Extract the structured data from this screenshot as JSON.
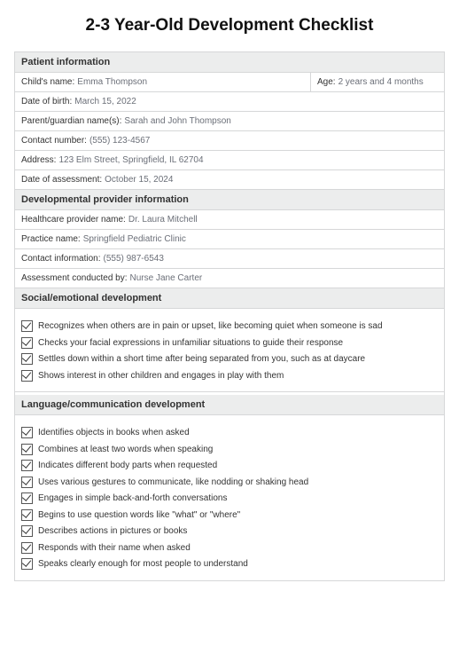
{
  "title": "2-3 Year-Old Development Checklist",
  "sections": {
    "patientInfo": {
      "header": "Patient information",
      "childNameLabel": "Child's name:",
      "childName": "Emma Thompson",
      "ageLabel": "Age:",
      "age": "2 years and 4 months",
      "dobLabel": "Date of birth:",
      "dob": "March 15, 2022",
      "guardianLabel": "Parent/guardian name(s):",
      "guardian": "Sarah and John Thompson",
      "contactLabel": "Contact number:",
      "contact": "(555) 123-4567",
      "addressLabel": "Address:",
      "address": "123 Elm Street, Springfield, IL 62704",
      "assessmentDateLabel": "Date of assessment:",
      "assessmentDate": "October 15, 2024"
    },
    "providerInfo": {
      "header": "Developmental provider information",
      "providerNameLabel": "Healthcare provider name:",
      "providerName": "Dr. Laura Mitchell",
      "practiceLabel": "Practice name:",
      "practice": "Springfield Pediatric Clinic",
      "contactInfoLabel": "Contact information:",
      "contactInfo": "(555) 987-6543",
      "conductedByLabel": "Assessment conducted by:",
      "conductedBy": "Nurse Jane Carter"
    },
    "socialEmotional": {
      "header": "Social/emotional development",
      "items": [
        "Recognizes when others are in pain or upset,  like becoming quiet when someone is sad",
        "Checks your facial expressions in unfamiliar situations to guide their response",
        "Settles down within a short time after being separated from you, such as at daycare",
        "Shows interest in other children and engages in play with them"
      ]
    },
    "languageComm": {
      "header": "Language/communication development",
      "items": [
        "Identifies objects in books when asked",
        "Combines at least two words when speaking",
        "Indicates different body parts when requested",
        "Uses various gestures to communicate, like nodding or shaking head",
        "Engages in simple back-and-forth conversations",
        "Begins to use question words like \"what\" or \"where\"",
        "Describes actions in pictures or books",
        "Responds with their name when asked",
        "Speaks clearly enough for most people to understand"
      ]
    }
  }
}
